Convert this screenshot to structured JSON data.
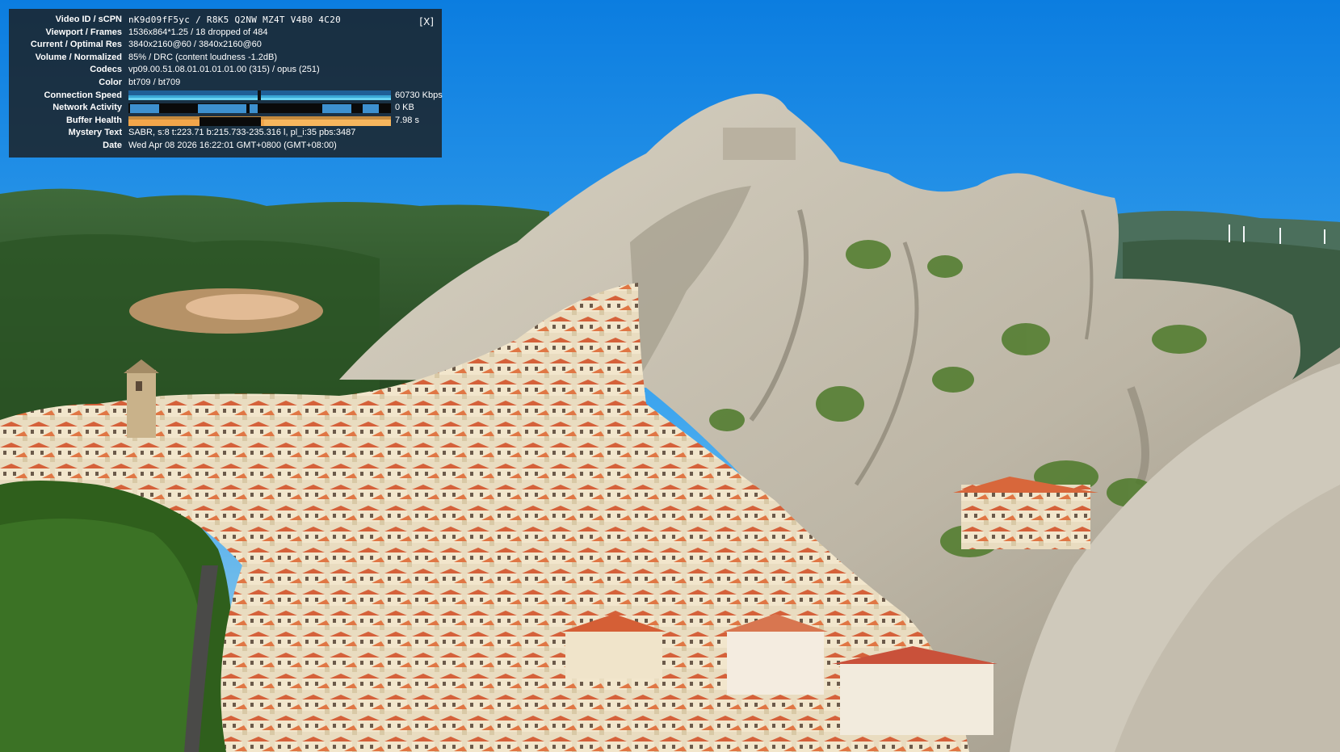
{
  "stats": {
    "close_label": "[X]",
    "rows": {
      "video_id": {
        "label": "Video ID / sCPN",
        "value": "nK9d09fF5yc / R8K5 Q2NW MZ4T V4B0 4C20"
      },
      "viewport": {
        "label": "Viewport / Frames",
        "value": "1536x864*1.25 / 18 dropped of 484"
      },
      "resolution": {
        "label": "Current / Optimal Res",
        "value": "3840x2160@60 / 3840x2160@60"
      },
      "volume": {
        "label": "Volume / Normalized",
        "value": "85% / DRC (content loudness -1.2dB)"
      },
      "codecs": {
        "label": "Codecs",
        "value": "vp09.00.51.08.01.01.01.01.00 (315) / opus (251)"
      },
      "color": {
        "label": "Color",
        "value": "bt709 / bt709"
      },
      "connection": {
        "label": "Connection Speed",
        "value": "60730 Kbps"
      },
      "network": {
        "label": "Network Activity",
        "value": "0 KB"
      },
      "buffer": {
        "label": "Buffer Health",
        "value": "7.98 s"
      },
      "mystery": {
        "label": "Mystery Text",
        "value": "SABR, s:8 t:223.71 b:215.733-235.316 l, pl_i:35 pbs:3487"
      },
      "date": {
        "label": "Date",
        "value": "Wed Apr 08 2026 16:22:01 GMT+0800 (GMT+08:00)"
      }
    },
    "colors": {
      "connection": "#2f7fbf",
      "connection_fill": "#37c8f0",
      "network": "#3a8fd0",
      "buffer": "#f3a64a"
    }
  },
  "scene": {
    "colors": {
      "sky_top": "#0d7fe0",
      "sky_bottom": "#7cc4ec",
      "rock": "#c9c3b4",
      "rock_shadow": "#8f897b",
      "forest": "#2d5a1d",
      "roof": "#d8673b",
      "wall": "#efe2c6"
    }
  }
}
